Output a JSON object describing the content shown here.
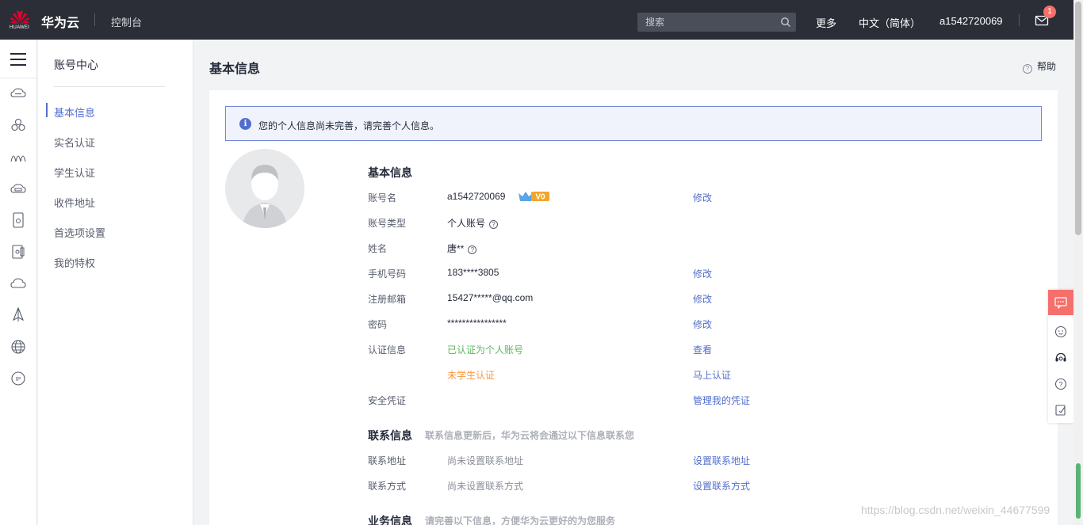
{
  "topbar": {
    "logo_text": "HUAWEI",
    "brand": "华为云",
    "console": "控制台",
    "search_placeholder": "搜索",
    "more": "更多",
    "language": "中文（简体）",
    "username": "a1542720069",
    "mail_badge": "1"
  },
  "rail": {
    "icons": [
      "menu-icon",
      "cloud-server-icon",
      "cloud-cluster-icon",
      "network-icon",
      "disk-icon",
      "storage-icon",
      "database-icon",
      "cloud-icon",
      "deploy-icon",
      "globe-icon",
      "ip-icon"
    ]
  },
  "subnav": {
    "title": "账号中心",
    "items": [
      {
        "label": "基本信息",
        "active": true
      },
      {
        "label": "实名认证"
      },
      {
        "label": "学生认证"
      },
      {
        "label": "收件地址"
      },
      {
        "label": "首选项设置"
      },
      {
        "label": "我的特权"
      }
    ]
  },
  "main": {
    "title": "基本信息",
    "help": "帮助",
    "alert": "您的个人信息尚未完善，请完善个人信息。",
    "basic": {
      "title": "基本信息",
      "rows": [
        {
          "label": "账号名",
          "value": "a1542720069",
          "action": "修改"
        },
        {
          "label": "账号类型",
          "value": "个人账号",
          "action": ""
        },
        {
          "label": "姓名",
          "value": "唐**",
          "action": ""
        },
        {
          "label": "手机号码",
          "value": "183****3805",
          "action": "修改"
        },
        {
          "label": "注册邮箱",
          "value": "15427*****@qq.com",
          "action": "修改"
        },
        {
          "label": "密码",
          "value": "****************",
          "action": "修改"
        },
        {
          "label": "认证信息",
          "value": "已认证为个人账号",
          "action": "查看"
        },
        {
          "label": "",
          "value": "未学生认证",
          "action": "马上认证"
        },
        {
          "label": "安全凭证",
          "value": "",
          "action": "管理我的凭证"
        }
      ],
      "vip_badge": "V0"
    },
    "contact": {
      "title": "联系信息",
      "subtitle": "联系信息更新后，华为云将会通过以下信息联系您",
      "rows": [
        {
          "label": "联系地址",
          "value": "尚未设置联系地址",
          "action": "设置联系地址"
        },
        {
          "label": "联系方式",
          "value": "尚未设置联系方式",
          "action": "设置联系方式"
        }
      ]
    },
    "business": {
      "title": "业务信息",
      "subtitle": "请完善以下信息，方便华为云更好的为您服务"
    }
  },
  "float_bar": {
    "icons": [
      "chat-icon",
      "feedback-face-icon",
      "headset-icon",
      "question-icon",
      "edit-note-icon"
    ]
  },
  "watermark": "https://blog.csdn.net/weixin_44677599",
  "colors": {
    "topbar": "#2b2e36",
    "link": "#526ecc",
    "green": "#5cb85c",
    "orange": "#fa9841",
    "float_accent": "#f66f6a"
  }
}
